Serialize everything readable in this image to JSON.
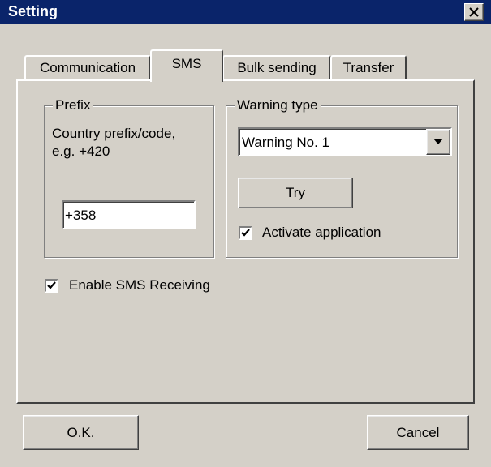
{
  "window": {
    "title": "Setting"
  },
  "tabs": [
    {
      "label": "Communication",
      "active": false
    },
    {
      "label": "SMS",
      "active": true
    },
    {
      "label": "Bulk sending",
      "active": false
    },
    {
      "label": "Transfer",
      "active": false
    }
  ],
  "prefix": {
    "group_label": "Prefix",
    "description_line1": "Country prefix/code,",
    "description_line2": "e.g. +420",
    "value": "+358"
  },
  "warning": {
    "group_label": "Warning type",
    "selected": "Warning No. 1",
    "try_label": "Try",
    "activate_label": "Activate application",
    "activate_checked": true
  },
  "sms": {
    "enable_receiving_label": "Enable SMS Receiving",
    "enable_receiving_checked": true
  },
  "buttons": {
    "ok_label": "O.K.",
    "cancel_label": "Cancel"
  },
  "icons": {
    "close": "close-icon",
    "dropdown": "chevron-down-icon",
    "check": "checkmark-icon"
  }
}
